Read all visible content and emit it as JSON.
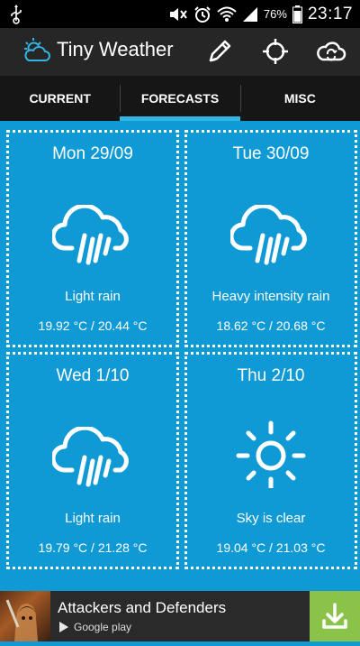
{
  "status_bar": {
    "battery": "76%",
    "time": "23:17"
  },
  "app": {
    "title": "Tiny Weather"
  },
  "actions": {
    "edit_icon": "pencil-icon",
    "locate_icon": "crosshair-icon",
    "sync_icon": "cloud-sync-icon"
  },
  "tabs": [
    {
      "label": "CURRENT",
      "active": false
    },
    {
      "label": "FORECASTS",
      "active": true
    },
    {
      "label": "MISC",
      "active": false
    }
  ],
  "forecasts": [
    {
      "date": "Mon 29/09",
      "icon": "rain-icon",
      "description": "Light rain",
      "temps": "19.92 °C / 20.44 °C"
    },
    {
      "date": "Tue 30/09",
      "icon": "rain-icon",
      "description": "Heavy intensity rain",
      "temps": "18.62 °C / 20.68 °C"
    },
    {
      "date": "Wed 1/10",
      "icon": "rain-icon",
      "description": "Light rain",
      "temps": "19.79 °C / 21.28 °C"
    },
    {
      "date": "Thu 2/10",
      "icon": "sun-icon",
      "description": "Sky is clear",
      "temps": "19.04 °C / 21.03 °C"
    }
  ],
  "ad": {
    "title": "Attackers and Defenders",
    "store": "Google play",
    "download_icon": "download-icon"
  },
  "colors": {
    "background": "#0f9ad6",
    "tab_indicator": "#33b5e5",
    "action_bar": "#262626",
    "download_button": "#8bc34a"
  }
}
